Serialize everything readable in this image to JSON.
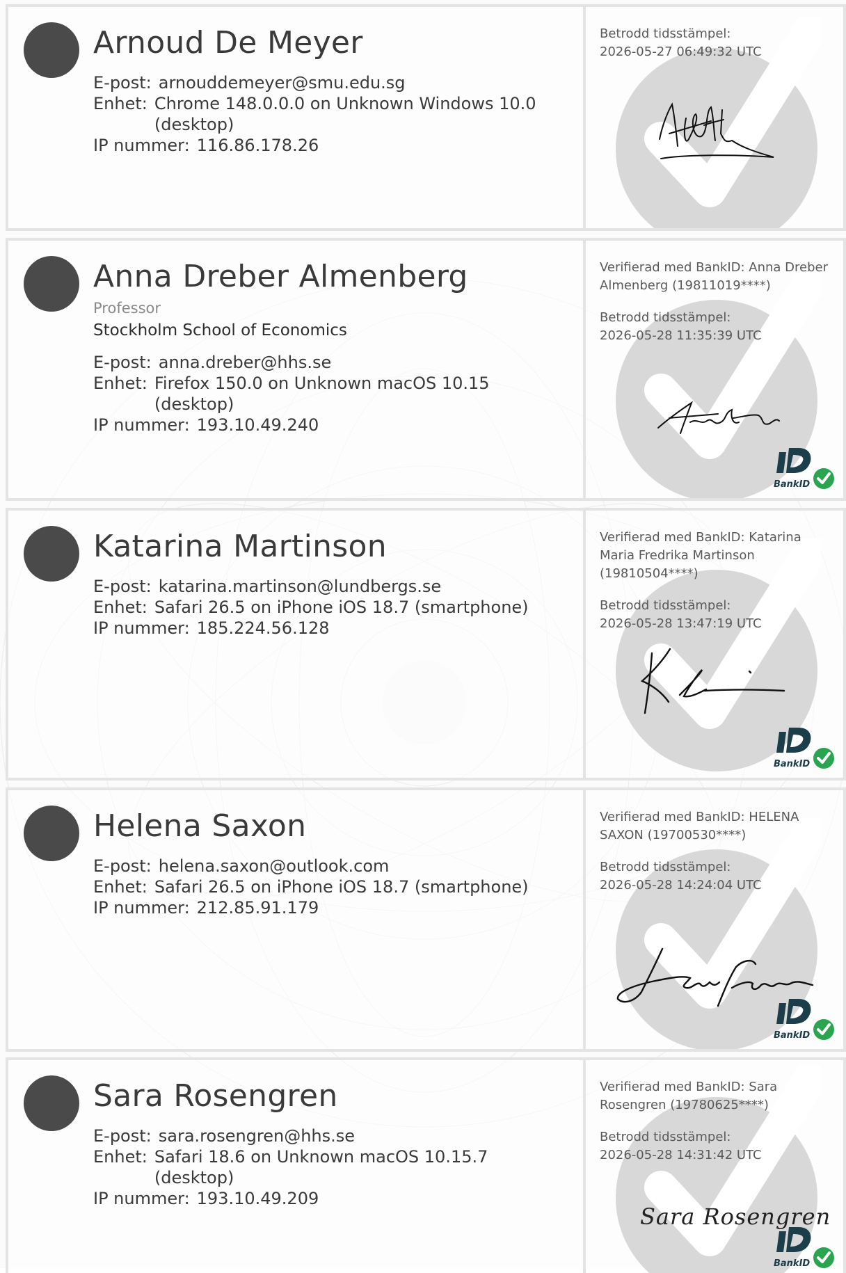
{
  "signers": [
    {
      "name": "Arnoud De Meyer",
      "details": [
        {
          "label": "E-post:",
          "value": "arnouddemeyer@smu.edu.sg"
        },
        {
          "label": "Enhet:",
          "value": "Chrome 148.0.0.0 on Unknown Windows 10.0 (desktop)"
        },
        {
          "label": "IP nummer:",
          "value": "116.86.178.26"
        }
      ],
      "timestamp_label": "Betrodd tidsstämpel:",
      "timestamp": "2026-05-27 06:49:32 UTC"
    },
    {
      "name": "Anna Dreber Almenberg",
      "role": "Professor",
      "organization": "Stockholm School of Economics",
      "details": [
        {
          "label": "E-post:",
          "value": "anna.dreber@hhs.se"
        },
        {
          "label": "Enhet:",
          "value": "Firefox 150.0 on Unknown macOS 10.15 (desktop)"
        },
        {
          "label": "IP nummer:",
          "value": "193.10.49.240"
        }
      ],
      "verified": "Verifierad med BankID: Anna Dreber Almenberg (19811019****)",
      "timestamp_label": "Betrodd tidsstämpel:",
      "timestamp": "2026-05-28 11:35:39 UTC"
    },
    {
      "name": "Katarina Martinson",
      "details": [
        {
          "label": "E-post:",
          "value": "katarina.martinson@lundbergs.se"
        },
        {
          "label": "Enhet:",
          "value": "Safari 26.5 on iPhone iOS 18.7 (smartphone)"
        },
        {
          "label": "IP nummer:",
          "value": "185.224.56.128"
        }
      ],
      "verified": "Verifierad med BankID: Katarina Maria Fredrika Martinson (19810504****)",
      "timestamp_label": "Betrodd tidsstämpel:",
      "timestamp": "2026-05-28 13:47:19 UTC"
    },
    {
      "name": "Helena Saxon",
      "details": [
        {
          "label": "E-post:",
          "value": "helena.saxon@outlook.com"
        },
        {
          "label": "Enhet:",
          "value": "Safari 26.5 on iPhone iOS 18.7 (smartphone)"
        },
        {
          "label": "IP nummer:",
          "value": "212.85.91.179"
        }
      ],
      "verified": "Verifierad med BankID: HELENA SAXON (19700530****)",
      "timestamp_label": "Betrodd tidsstämpel:",
      "timestamp": "2026-05-28 14:24:04 UTC"
    },
    {
      "name": "Sara Rosengren",
      "details": [
        {
          "label": "E-post:",
          "value": "sara.rosengren@hhs.se"
        },
        {
          "label": "Enhet:",
          "value": "Safari 18.6 on Unknown macOS 10.15.7 (desktop)"
        },
        {
          "label": "IP nummer:",
          "value": "193.10.49.209"
        }
      ],
      "verified": "Verifierad med BankID: Sara Rosengren (19780625****)",
      "timestamp_label": "Betrodd tidsstämpel:",
      "timestamp": "2026-05-28 14:31:42 UTC",
      "signature_text": "Sara Rosengren"
    }
  ],
  "bankid_logo_text": "BankID",
  "colors": {
    "avatar": "#4a4a4a",
    "check_circle": "#d8d8d8",
    "border": "#e4e4e4",
    "bankid_dark": "#1c3d4a",
    "bankid_green": "#2aa44f"
  }
}
